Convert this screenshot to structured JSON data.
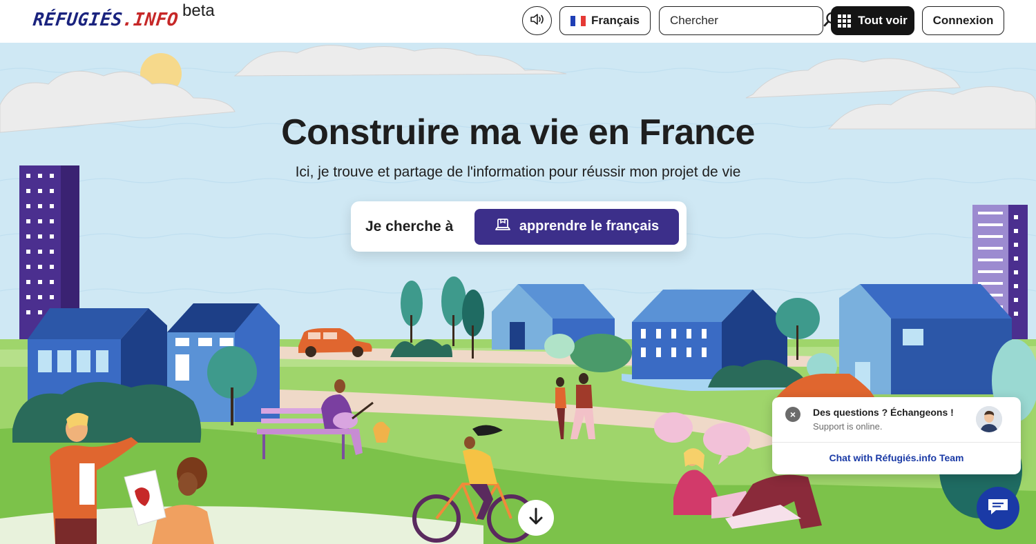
{
  "header": {
    "logo_main": "RÉFUGIÉS",
    "logo_dot": ".",
    "logo_suffix": "INFO",
    "logo_badge": "beta",
    "language_label": "Français",
    "search_placeholder": "Chercher",
    "see_all_label": "Tout voir",
    "login_label": "Connexion",
    "icons": [
      "speaker-icon",
      "french-flag-icon",
      "search-icon",
      "grid-icon"
    ]
  },
  "hero": {
    "title": "Construire ma vie en France",
    "subtitle": "Ici, je trouve et partage de l'information pour réussir mon projet de vie",
    "search_prefix": "Je cherche à",
    "search_theme": "apprendre le français",
    "theme_icon": "laptop-icon",
    "scroll_icon": "arrow-down-icon"
  },
  "chat": {
    "title": "Des questions ? Échangeons !",
    "status": "Support is online.",
    "link": "Chat with Réfugiés.info Team",
    "close_symbol": "×"
  },
  "colors": {
    "brand_blue": "#1a237e",
    "brand_red": "#c62828",
    "cta_purple": "#3c2f8a",
    "chat_blue": "#1a3aa6",
    "sky": "#cfe8f4",
    "grass": "#9fd56b"
  }
}
